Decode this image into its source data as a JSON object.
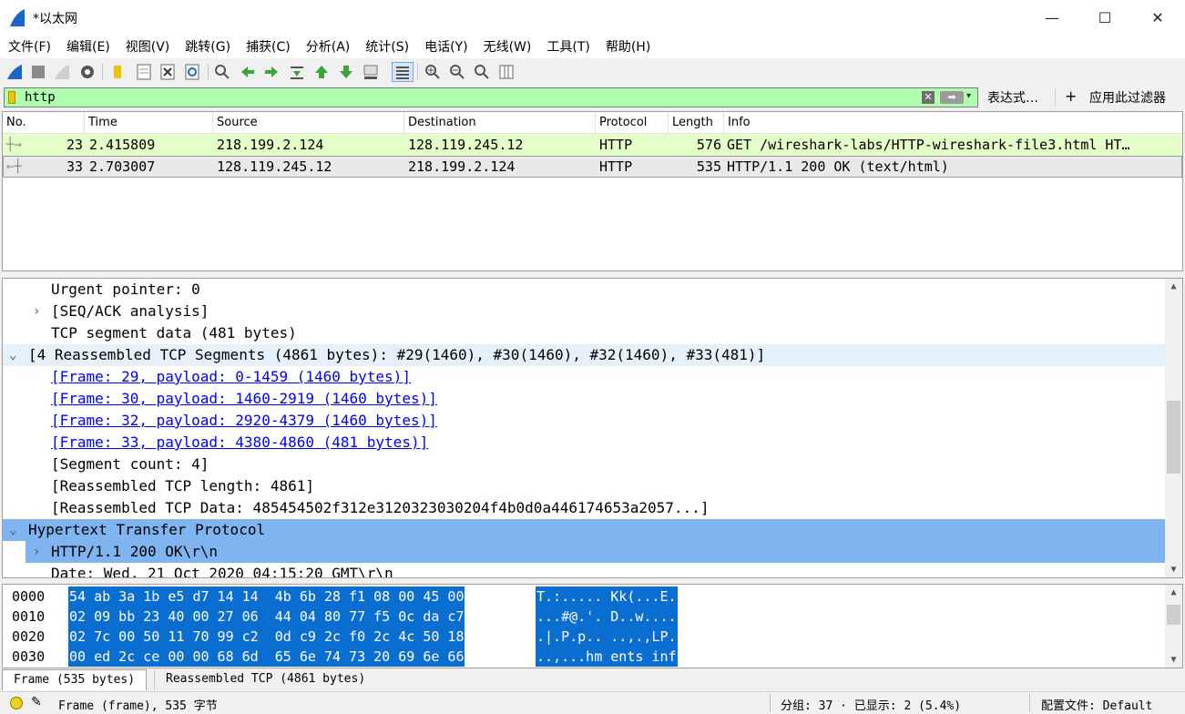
{
  "window": {
    "title": "*以太网"
  },
  "menu": [
    "文件(F)",
    "编辑(E)",
    "视图(V)",
    "跳转(G)",
    "捕获(C)",
    "分析(A)",
    "统计(S)",
    "电话(Y)",
    "无线(W)",
    "工具(T)",
    "帮助(H)"
  ],
  "toolbar": {
    "icons": [
      "shark-fin-start-icon",
      "stop-square-icon",
      "restart-fin-icon",
      "capture-options-gear-icon",
      "open-folder-icon",
      "file-icon",
      "close-file-icon",
      "reload-icon",
      "find-magnifier-icon",
      "go-back-arrow-icon",
      "go-forward-arrow-icon",
      "go-to-packet-icon",
      "first-packet-icon",
      "last-packet-icon",
      "auto-scroll-icon",
      "colorize-icon",
      "zoom-in-icon",
      "zoom-out-icon",
      "zoom-normal-icon",
      "resize-columns-icon"
    ]
  },
  "filter": {
    "value": "http",
    "expression_label": "表达式…",
    "add_label": "+",
    "apply_label": "应用此过滤器"
  },
  "packet_list": {
    "columns": [
      "No.",
      "Time",
      "Source",
      "Destination",
      "Protocol",
      "Length",
      "Info"
    ],
    "rows": [
      {
        "no": "23",
        "time": "2.415809",
        "source": "218.199.2.124",
        "destination": "128.119.245.12",
        "protocol": "HTTP",
        "length": "576",
        "info": "GET /wireshark-labs/HTTP-wireshark-file3.html HT…"
      },
      {
        "no": "33",
        "time": "2.703007",
        "source": "128.119.245.12",
        "destination": "218.199.2.124",
        "protocol": "HTTP",
        "length": "535",
        "info": "HTTP/1.1 200 OK  (text/html)"
      }
    ],
    "row_colors": {
      "http_bg": "#e4ffc7",
      "selected_bg": "#e9e9e9"
    }
  },
  "details": {
    "lines": [
      "Urgent pointer: 0",
      "[SEQ/ACK analysis]",
      "TCP segment data (481 bytes)",
      "[4 Reassembled TCP Segments (4861 bytes): #29(1460), #30(1460), #32(1460), #33(481)]",
      "[Frame: 29, payload: 0-1459 (1460 bytes)]",
      "[Frame: 30, payload: 1460-2919 (1460 bytes)]",
      "[Frame: 32, payload: 2920-4379 (1460 bytes)]",
      "[Frame: 33, payload: 4380-4860 (481 bytes)]",
      "[Segment count: 4]",
      "[Reassembled TCP length: 4861]",
      "[Reassembled TCP Data: 485454502f312e3120323030204f4b0d0a446174653a2057...]",
      "Hypertext Transfer Protocol",
      "HTTP/1.1 200 OK\\r\\n",
      "Date: Wed, 21 Oct 2020 04:15:20 GMT\\r\\n"
    ]
  },
  "hex": {
    "rows": [
      {
        "offset": "0000",
        "bytes": "54 ab 3a 1b e5 d7 14 14  4b 6b 28 f1 08 00 45 00",
        "ascii": "T.:..... Kk(...E."
      },
      {
        "offset": "0010",
        "bytes": "02 09 bb 23 40 00 27 06  44 04 80 77 f5 0c da c7",
        "ascii": "...#@.'. D..w...."
      },
      {
        "offset": "0020",
        "bytes": "02 7c 00 50 11 70 99 c2  0d c9 2c f0 2c 4c 50 18",
        "ascii": ".|.P.p.. ..,.,LP."
      },
      {
        "offset": "0030",
        "bytes": "00 ed 2c ce 00 00 68 6d  65 6e 74 73 20 69 6e 66",
        "ascii": "..,...hm ents inf"
      }
    ]
  },
  "tabs": [
    "Frame (535 bytes)",
    "Reassembled TCP (4861 bytes)"
  ],
  "status": {
    "frame": "Frame (frame), 535 字节",
    "packets": "分组: 37 · 已显示: 2 (5.4%)",
    "profile": "配置文件: Default"
  }
}
